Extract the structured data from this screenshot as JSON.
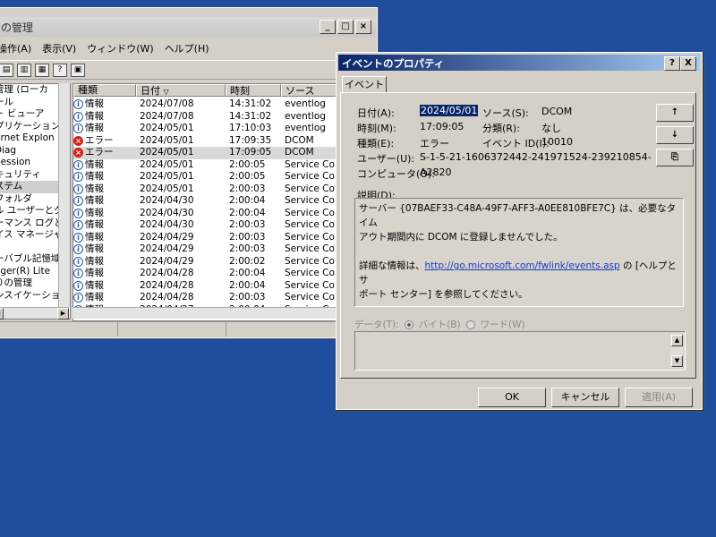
{
  "mgmt": {
    "title": "の管理",
    "menu": [
      "操作(A)",
      "表示(V)",
      "ウィンドウ(W)",
      "ヘルプ(H)"
    ],
    "tree": [
      "管理 (ローカ",
      "ール",
      "ト ビューア",
      "プリケーション",
      "ernet Explon",
      "Diag",
      "Session",
      "キュリティ",
      "ステム",
      "フォルダ",
      "ル ユーザーとグ",
      "ーマンス ログと",
      "イス マネージャ",
      "",
      "ーバブル記憶域",
      "ager(R) Lite",
      "りの管理",
      "ンスイケーション"
    ],
    "tree_selected_index": 8,
    "columns": [
      "種類",
      "日付",
      "時刻",
      "ソース"
    ],
    "sort_indicator": "▽",
    "rows": [
      {
        "type": "info",
        "label": "情報",
        "date": "2024/07/08",
        "time": "14:31:02",
        "source": "eventlog"
      },
      {
        "type": "info",
        "label": "情報",
        "date": "2024/07/08",
        "time": "14:31:02",
        "source": "eventlog"
      },
      {
        "type": "info",
        "label": "情報",
        "date": "2024/05/01",
        "time": "17:10:03",
        "source": "eventlog"
      },
      {
        "type": "error",
        "label": "エラー",
        "date": "2024/05/01",
        "time": "17:09:35",
        "source": "DCOM"
      },
      {
        "type": "error",
        "label": "エラー",
        "date": "2024/05/01",
        "time": "17:09:05",
        "source": "DCOM",
        "selected": true
      },
      {
        "type": "info",
        "label": "情報",
        "date": "2024/05/01",
        "time": "2:00:05",
        "source": "Service Co"
      },
      {
        "type": "info",
        "label": "情報",
        "date": "2024/05/01",
        "time": "2:00:05",
        "source": "Service Co"
      },
      {
        "type": "info",
        "label": "情報",
        "date": "2024/05/01",
        "time": "2:00:03",
        "source": "Service Co"
      },
      {
        "type": "info",
        "label": "情報",
        "date": "2024/04/30",
        "time": "2:00:04",
        "source": "Service Co"
      },
      {
        "type": "info",
        "label": "情報",
        "date": "2024/04/30",
        "time": "2:00:04",
        "source": "Service Co"
      },
      {
        "type": "info",
        "label": "情報",
        "date": "2024/04/30",
        "time": "2:00:03",
        "source": "Service Co"
      },
      {
        "type": "info",
        "label": "情報",
        "date": "2024/04/29",
        "time": "2:00:03",
        "source": "Service Co"
      },
      {
        "type": "info",
        "label": "情報",
        "date": "2024/04/29",
        "time": "2:00:03",
        "source": "Service Co"
      },
      {
        "type": "info",
        "label": "情報",
        "date": "2024/04/29",
        "time": "2:00:02",
        "source": "Service Co"
      },
      {
        "type": "info",
        "label": "情報",
        "date": "2024/04/28",
        "time": "2:00:04",
        "source": "Service Co"
      },
      {
        "type": "info",
        "label": "情報",
        "date": "2024/04/28",
        "time": "2:00:04",
        "source": "Service Co"
      },
      {
        "type": "info",
        "label": "情報",
        "date": "2024/04/28",
        "time": "2:00:03",
        "source": "Service Co"
      },
      {
        "type": "info",
        "label": "情報",
        "date": "2024/04/27",
        "time": "2:00:04",
        "source": "Service Co"
      }
    ]
  },
  "dialog": {
    "title": "イベントのプロパティ",
    "help_btn": "?",
    "close_btn": "X",
    "tab": "イベント",
    "fields": {
      "date_label": "日付(A):",
      "date_value": "2024/05/01",
      "source_label": "ソース(S):",
      "source_value": "DCOM",
      "time_label": "時刻(M):",
      "time_value": "17:09:05",
      "category_label": "分類(R):",
      "category_value": "なし",
      "type_label": "種類(E):",
      "type_value": "エラー",
      "eventid_label": "イベント ID(I):",
      "eventid_value": "10010",
      "user_label": "ユーザー(U):",
      "user_value": "S-1-5-21-1606372442-241971524-239210854-",
      "computer_label": "コンピュータ(O):",
      "computer_value": "A2820"
    },
    "nav": {
      "up": "↑",
      "down": "↓",
      "copy": "⎘"
    },
    "description_label": "説明(D):",
    "description_line1": "サーバー {07BAEF33-C48A-49F7-AFF3-A0EE810BFE7C} は、必要なタイム",
    "description_line2": "アウト期間内に DCOM に登録しませんでした。",
    "description_more_prefix": "詳細な情報は、",
    "description_link": "http://go.microsoft.com/fwlink/events.asp",
    "description_more_suffix1": " の [ヘルプとサ",
    "description_more_suffix2": "ポート センター] を参照してください。",
    "data_label": "データ(T):",
    "data_bytes": "バイト(B)",
    "data_words": "ワード(W)",
    "buttons": {
      "ok": "OK",
      "cancel": "キャンセル",
      "apply": "適用(A)"
    }
  }
}
